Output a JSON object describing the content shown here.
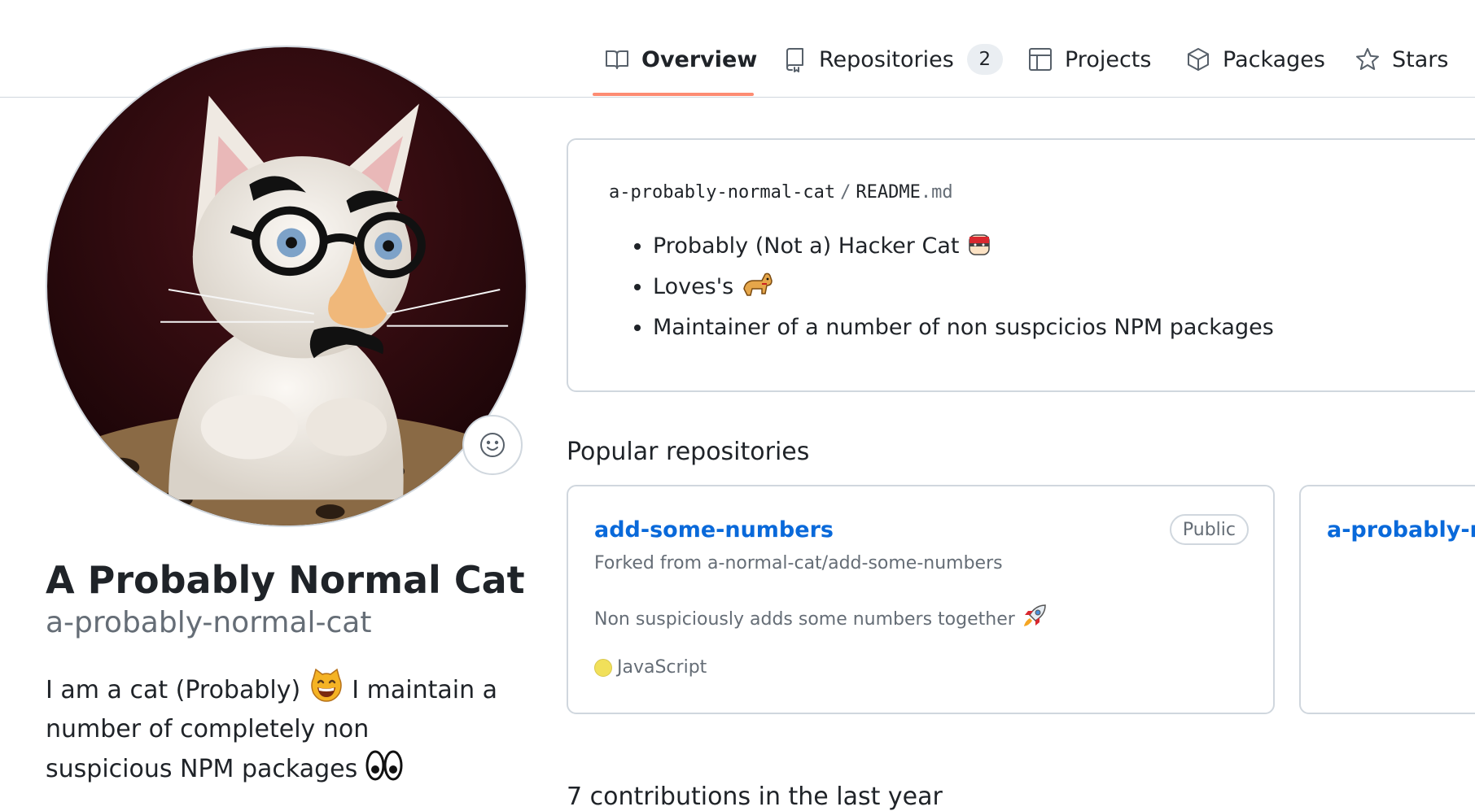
{
  "tabs": {
    "overview": "Overview",
    "repositories": "Repositories",
    "repositories_count": "2",
    "projects": "Projects",
    "packages": "Packages",
    "stars": "Stars"
  },
  "profile": {
    "name": "A Probably Normal Cat",
    "login": "a-probably-normal-cat",
    "bio_part1": "I am a cat (Probably)",
    "bio_part2": "I maintain a number of completely non suspicious NPM packages"
  },
  "readme": {
    "owner": "a-probably-normal-cat",
    "separator": "/",
    "file_base": "README",
    "file_ext": ".md",
    "items": [
      "Probably (Not a) Hacker Cat",
      "Loves's",
      "Maintainer of a number of non suspcicios NPM packages"
    ]
  },
  "popular": {
    "title": "Popular repositories",
    "repos": [
      {
        "name": "add-some-numbers",
        "visibility": "Public",
        "forked_prefix": "Forked from",
        "forked_from": "a-normal-cat/add-some-numbers",
        "description": "Non suspiciously adds some numbers together",
        "language": "JavaScript",
        "language_color": "#f1e05a"
      },
      {
        "name": "a-probably-no"
      }
    ]
  },
  "contributions": {
    "text": "7 contributions in the last year"
  },
  "icons": {
    "overview": "book-icon",
    "repositories": "repo-icon",
    "projects": "table-icon",
    "packages": "package-icon",
    "stars": "star-icon",
    "status": "smiley-icon"
  },
  "colors": {
    "link": "#0969da",
    "tab_underline": "#fd8c73",
    "border": "#d0d7de",
    "muted": "#656d76"
  }
}
